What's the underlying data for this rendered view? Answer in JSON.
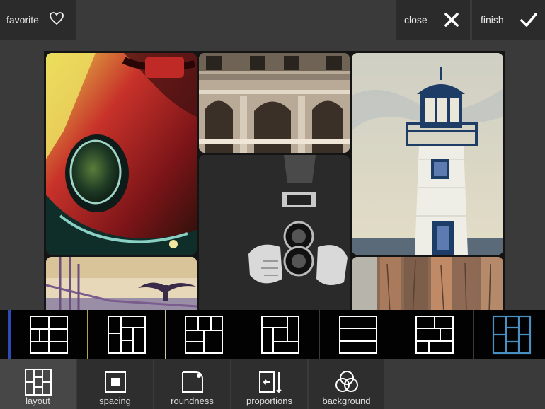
{
  "top_bar": {
    "favorite_label": "favorite",
    "favorite_icon": "heart-icon",
    "close_label": "close",
    "close_icon": "x-icon",
    "finish_label": "finish",
    "finish_icon": "checkmark-icon"
  },
  "layout_strip": {
    "selected_index": 6,
    "selected_color": "#4a90c2",
    "items": [
      {
        "icon": "layout-grid-1-icon"
      },
      {
        "icon": "layout-grid-2-icon"
      },
      {
        "icon": "layout-grid-3-icon"
      },
      {
        "icon": "layout-grid-4-icon"
      },
      {
        "icon": "layout-grid-5-icon"
      },
      {
        "icon": "layout-grid-6-icon"
      },
      {
        "icon": "layout-grid-7-icon"
      }
    ]
  },
  "toolbar": {
    "active": "layout",
    "items": [
      {
        "label": "layout",
        "icon": "layout-icon"
      },
      {
        "label": "spacing",
        "icon": "spacing-icon"
      },
      {
        "label": "roundness",
        "icon": "roundness-icon"
      },
      {
        "label": "proportions",
        "icon": "proportions-icon"
      },
      {
        "label": "background",
        "icon": "background-icon"
      }
    ]
  }
}
